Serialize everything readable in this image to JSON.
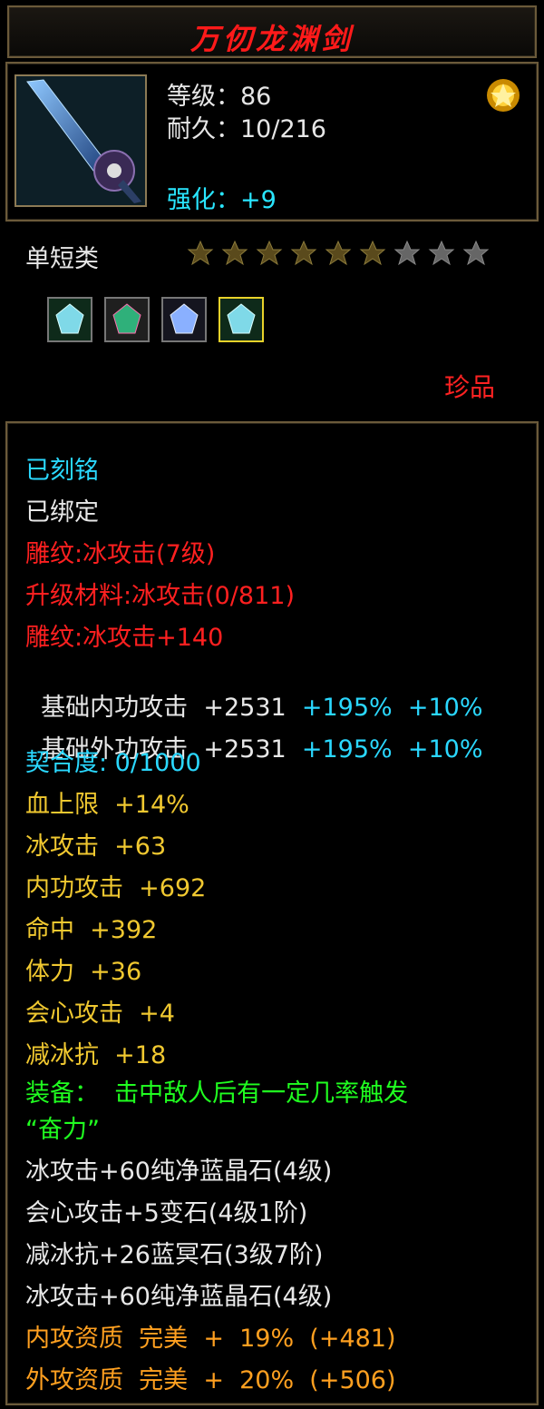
{
  "title": "万仞龙渊剑",
  "header": {
    "level_label": "等级：86",
    "durability_label": "耐久：10/216",
    "enhance_label": "强化：+9"
  },
  "category": "单短类",
  "rating": {
    "filled": 6,
    "total": 9
  },
  "rarity": "珍品",
  "lines": {
    "engraved": "已刻铭",
    "bound": "已绑定",
    "carve1": "雕纹:冰攻击(7级)",
    "upgrade_mat": "升级材料:冰攻击(0/811)",
    "carve2": "雕纹:冰攻击+140",
    "base_inner": "基础内功攻击  +2531",
    "base_inner_pct": "+195%",
    "base_inner_pct2": "+10%",
    "base_outer": "基础外功攻击  +2531",
    "base_outer_pct": "+195%",
    "base_outer_pct2": "+10%",
    "fit": "契合度: 0/1000",
    "hp": "血上限  +14%",
    "ice_atk": "冰攻击  +63",
    "inner_atk": "内功攻击  +692",
    "hit": "命中  +392",
    "stamina": "体力  +36",
    "crit": "会心攻击  +4",
    "ice_res": "减冰抗  +18",
    "equip1": "装备：  击中敌人后有一定几率触发",
    "equip2": "“奋力”",
    "gem1": "冰攻击+60纯净蓝晶石(4级)",
    "gem2": "会心攻击+5变石(4级1阶)",
    "gem3": "减冰抗+26蓝冥石(3级7阶)",
    "gem4": "冰攻击+60纯净蓝晶石(4级)",
    "q_inner": "内攻资质  完美  +  19%  (+481)",
    "q_outer": "外攻资质  完美  +  20%  (+506)"
  }
}
